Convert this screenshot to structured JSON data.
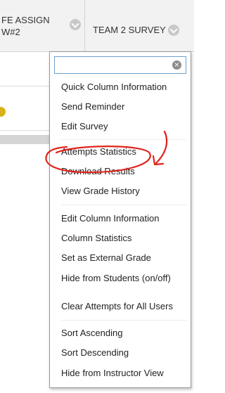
{
  "header": {
    "column_left_label": "FE ASSIGN W#2",
    "column_right_label": "TEAM 2 SURVEY"
  },
  "menu": {
    "search_placeholder": "",
    "clear_icon": "clear-icon",
    "items": [
      "Quick Column Information",
      "Send Reminder",
      "Edit Survey",
      "Attempts Statistics",
      "Download Results",
      "View Grade History",
      "Edit Column Information",
      "Column Statistics",
      "Set as External Grade",
      "Hide from Students (on/off)",
      "Clear Attempts for All Users",
      "Sort Ascending",
      "Sort Descending",
      "Hide from Instructor View"
    ]
  },
  "colors": {
    "annotation": "#e0231b",
    "status_dot": "#d9b21b",
    "search_border": "#6fa0cf"
  }
}
